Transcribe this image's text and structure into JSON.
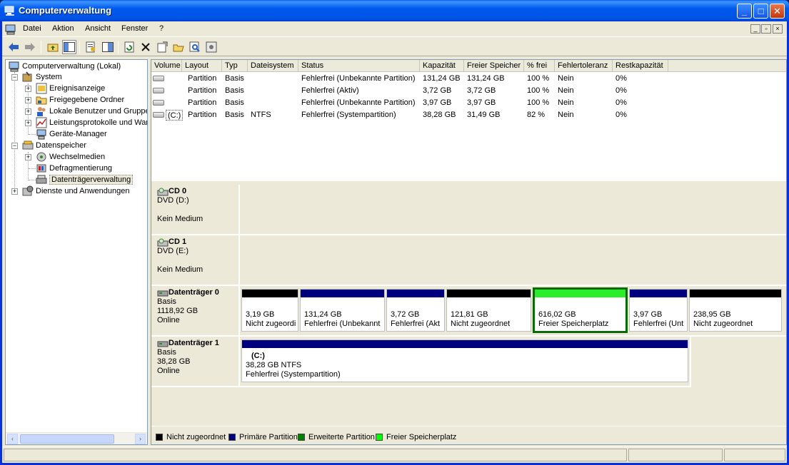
{
  "window": {
    "title": "Computerverwaltung",
    "controls": [
      "minimize-icon",
      "maximize-icon",
      "close-icon"
    ]
  },
  "menu": {
    "items": [
      "Datei",
      "Aktion",
      "Ansicht",
      "Fenster",
      "?"
    ]
  },
  "tree": {
    "root": "Computerverwaltung (Lokal)",
    "system": "System",
    "system_children": [
      "Ereignisanzeige",
      "Freigegebene Ordner",
      "Lokale Benutzer und Gruppe",
      "Leistungsprotokolle und War",
      "Geräte-Manager"
    ],
    "storage": "Datenspeicher",
    "storage_children": [
      "Wechselmedien",
      "Defragmentierung",
      "Datenträgerverwaltung"
    ],
    "services": "Dienste und Anwendungen"
  },
  "volumes": {
    "headers": [
      "Volume",
      "Layout",
      "Typ",
      "Dateisystem",
      "Status",
      "Kapazität",
      "Freier Speicher",
      "% frei",
      "Fehlertoleranz",
      "Restkapazität"
    ],
    "rows": [
      [
        "",
        "Partition",
        "Basis",
        "",
        "Fehlerfrei (Unbekannte Partition)",
        "131,24 GB",
        "131,24 GB",
        "100 %",
        "Nein",
        "0%"
      ],
      [
        "",
        "Partition",
        "Basis",
        "",
        "Fehlerfrei (Aktiv)",
        "3,72 GB",
        "3,72 GB",
        "100 %",
        "Nein",
        "0%"
      ],
      [
        "",
        "Partition",
        "Basis",
        "",
        "Fehlerfrei (Unbekannte Partition)",
        "3,97 GB",
        "3,97 GB",
        "100 %",
        "Nein",
        "0%"
      ],
      [
        "(C:)",
        "Partition",
        "Basis",
        "NTFS",
        "Fehlerfrei (Systempartition)",
        "38,28 GB",
        "31,49 GB",
        "82 %",
        "Nein",
        "0%"
      ]
    ]
  },
  "disks": {
    "cd0": {
      "name": "CD 0",
      "l1": "DVD (D:)",
      "l2": "",
      "l3": "Kein Medium"
    },
    "cd1": {
      "name": "CD 1",
      "l1": "DVD (E:)",
      "l2": "",
      "l3": "Kein Medium"
    },
    "disk0": {
      "name": "Datenträger 0",
      "l1": "Basis",
      "l2": "1118,92 GB",
      "l3": "Online",
      "partitions": [
        {
          "size": "3,19 GB",
          "status": "Nicht zugeordi",
          "kind": "unallocated"
        },
        {
          "size": "131,24 GB",
          "status": "Fehlerfrei (Unbekannt",
          "kind": "primary"
        },
        {
          "size": "3,72 GB",
          "status": "Fehlerfrei (Akt",
          "kind": "primary"
        },
        {
          "size": "121,81 GB",
          "status": "Nicht zugeordnet",
          "kind": "unallocated"
        },
        {
          "size": "616,02 GB",
          "status": "Freier Speicherplatz",
          "kind": "free"
        },
        {
          "size": "3,97 GB",
          "status": "Fehlerfrei (Unt",
          "kind": "primary"
        },
        {
          "size": "238,95 GB",
          "status": "Nicht zugeordnet",
          "kind": "unallocated"
        }
      ]
    },
    "disk1": {
      "name": "Datenträger 1",
      "l1": "Basis",
      "l2": "38,28 GB",
      "l3": "Online",
      "partition": {
        "label": "(C:)",
        "size": "38,28 GB NTFS",
        "status": "Fehlerfrei (Systempartition)"
      }
    }
  },
  "legend": [
    {
      "label": "Nicht zugeordnet",
      "color": "#000000"
    },
    {
      "label": "Primäre Partition",
      "color": "#00007f"
    },
    {
      "label": "Erweiterte Partition",
      "color": "#007f00"
    },
    {
      "label": "Freier Speicherplatz",
      "color": "#00ff00"
    }
  ],
  "colors": {
    "unallocated": "#000000",
    "primary": "#00007f",
    "extended": "#007f00",
    "free": "#2bee2b"
  }
}
